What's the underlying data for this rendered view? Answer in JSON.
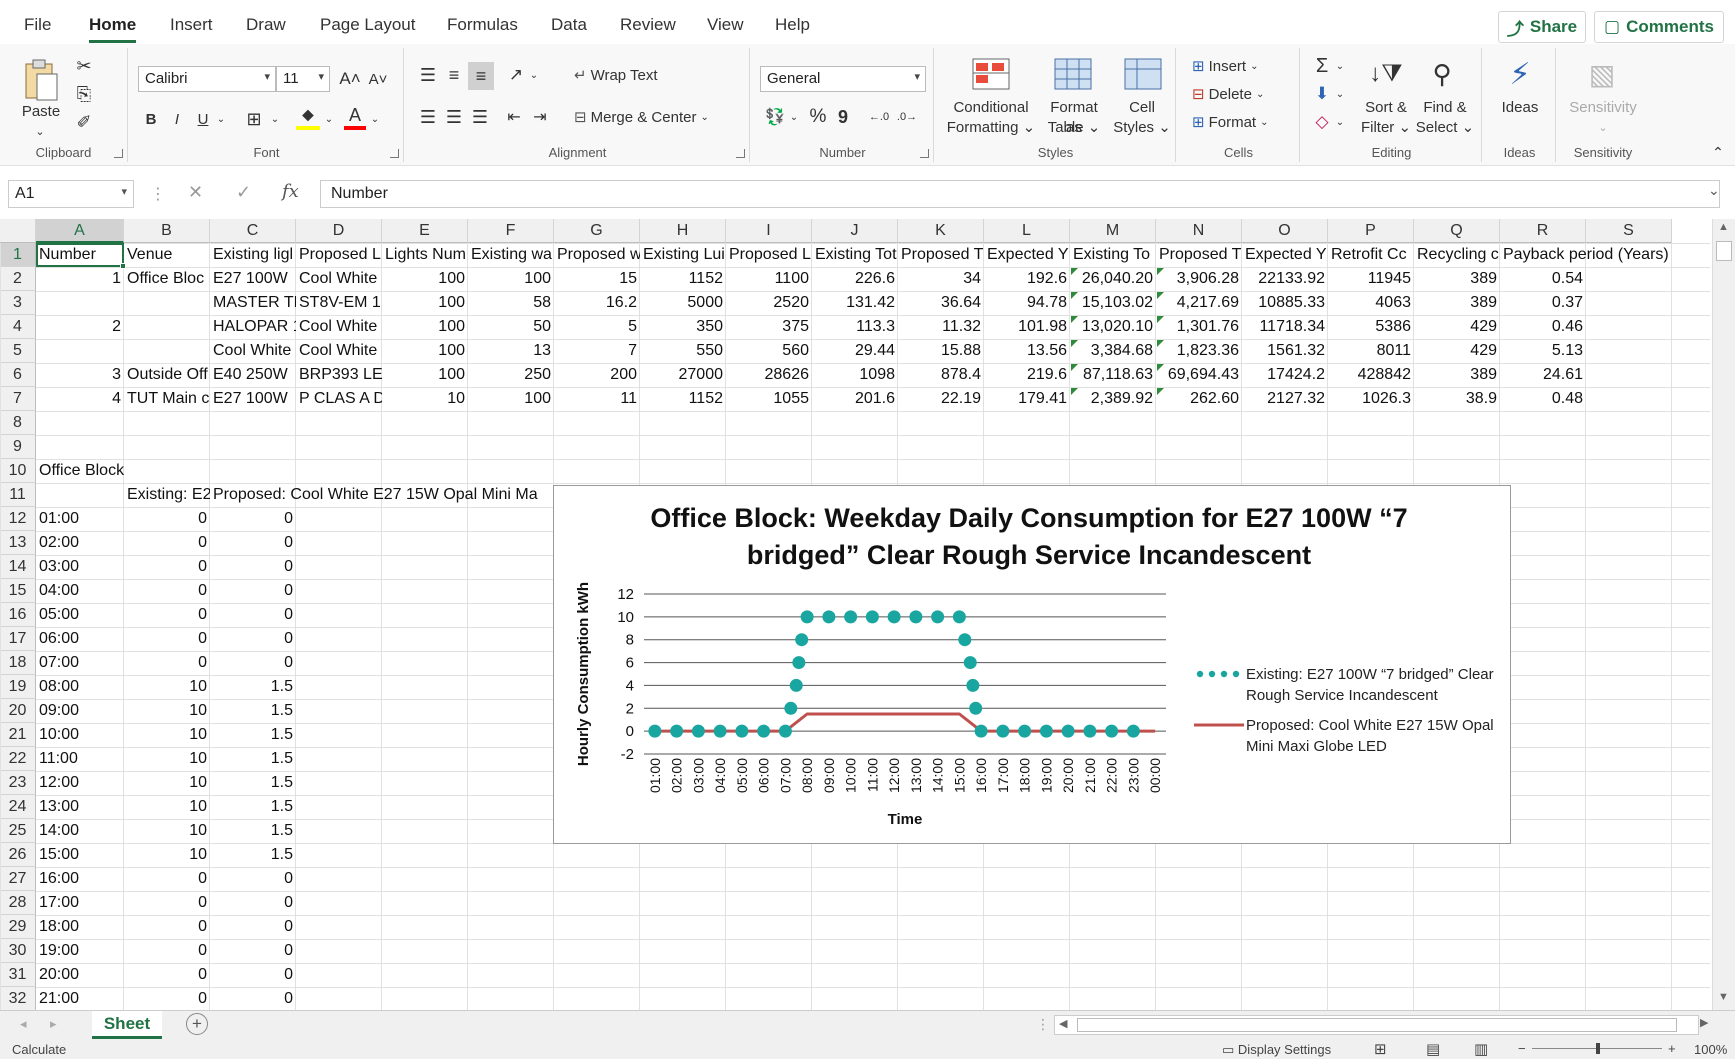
{
  "menu": {
    "tabs": [
      "File",
      "Home",
      "Insert",
      "Draw",
      "Page Layout",
      "Formulas",
      "Data",
      "Review",
      "View",
      "Help"
    ],
    "share_label": "Share",
    "comments_label": "Comments"
  },
  "ribbon": {
    "clipboard": {
      "paste_label": "Paste",
      "group_label": "Clipboard"
    },
    "font": {
      "font_name": "Calibri",
      "font_size": "11",
      "bold": "B",
      "italic": "I",
      "underline": "U",
      "group_label": "Font"
    },
    "alignment": {
      "wrap_text": "Wrap Text",
      "merge_center": "Merge & Center",
      "group_label": "Alignment"
    },
    "number": {
      "format": "General",
      "percent": "%",
      "comma": "9",
      "group_label": "Number"
    },
    "styles": {
      "conditional": "Conditional",
      "conditional2": "Formatting",
      "format_as": "Format as",
      "format_as2": "Table",
      "cell": "Cell",
      "cell2": "Styles",
      "group_label": "Styles"
    },
    "cells": {
      "insert": "Insert",
      "delete": "Delete",
      "format": "Format",
      "group_label": "Cells"
    },
    "editing": {
      "sort": "Sort &",
      "sort2": "Filter",
      "find": "Find &",
      "find2": "Select",
      "group_label": "Editing"
    },
    "ideas": {
      "label": "Ideas",
      "group_label": "Ideas"
    },
    "sensitivity": {
      "label": "Sensitivity",
      "group_label": "Sensitivity"
    }
  },
  "formula_bar": {
    "name_box": "A1",
    "fx": "fx",
    "content": "Number"
  },
  "columns": [
    "A",
    "B",
    "C",
    "D",
    "E",
    "F",
    "G",
    "H",
    "I",
    "J",
    "K",
    "L",
    "M",
    "N",
    "O",
    "P",
    "Q",
    "R",
    "S"
  ],
  "rows": [
    [
      "Number",
      "Venue",
      "Existing ligl",
      "Proposed L",
      "Lights Num",
      "Existing wa",
      "Proposed w",
      "Existing Lui",
      "Proposed L",
      "Existing Tot",
      "Proposed T",
      "Expected Y",
      "Existing To",
      "Proposed T",
      "Expected Y",
      "Retrofit Cc",
      "Recycling c",
      "Payback period (Years)",
      ""
    ],
    [
      "1",
      "Office Bloc",
      "E27 100W",
      "Cool White",
      "100",
      "100",
      "15",
      "1152",
      "1100",
      "226.6",
      "34",
      "192.6",
      "26,040.20",
      "3,906.28",
      "22133.92",
      "11945",
      "389",
      "0.54",
      ""
    ],
    [
      "",
      "",
      "MASTER TL",
      "ST8V-EM 1",
      "100",
      "58",
      "16.2",
      "5000",
      "2520",
      "131.42",
      "36.64",
      "94.78",
      "15,103.02",
      "4,217.69",
      "10885.33",
      "4063",
      "389",
      "0.37",
      ""
    ],
    [
      "2",
      "",
      "HALOPAR 1",
      "Cool White",
      "100",
      "50",
      "5",
      "350",
      "375",
      "113.3",
      "11.32",
      "101.98",
      "13,020.10",
      "1,301.76",
      "11718.34",
      "5386",
      "429",
      "0.46",
      ""
    ],
    [
      "",
      "",
      "Cool White",
      "Cool White",
      "100",
      "13",
      "7",
      "550",
      "560",
      "29.44",
      "15.88",
      "13.56",
      "3,384.68",
      "1,823.36",
      "1561.32",
      "8011",
      "429",
      "5.13",
      ""
    ],
    [
      "3",
      "Outside Off",
      "E40 250W",
      "BRP393 LEI",
      "100",
      "250",
      "200",
      "27000",
      "28626",
      "1098",
      "878.4",
      "219.6",
      "87,118.63",
      "69,694.43",
      "17424.2",
      "428842",
      "389",
      "24.61",
      ""
    ],
    [
      "4",
      "TUT Main c",
      "E27 100W",
      "P CLAS A D",
      "10",
      "100",
      "11",
      "1152",
      "1055",
      "201.6",
      "22.19",
      "179.41",
      "2,389.92",
      "262.60",
      "2127.32",
      "1026.3",
      "38.9",
      "0.48",
      ""
    ]
  ],
  "office_block_label": "Office Block",
  "series_header_existing": "Existing: E2",
  "series_header_proposed": "Proposed: Cool White E27 15W Opal Mini Ma",
  "hourly": [
    [
      "01:00",
      "0",
      "0"
    ],
    [
      "02:00",
      "0",
      "0"
    ],
    [
      "03:00",
      "0",
      "0"
    ],
    [
      "04:00",
      "0",
      "0"
    ],
    [
      "05:00",
      "0",
      "0"
    ],
    [
      "06:00",
      "0",
      "0"
    ],
    [
      "07:00",
      "0",
      "0"
    ],
    [
      "08:00",
      "10",
      "1.5"
    ],
    [
      "09:00",
      "10",
      "1.5"
    ],
    [
      "10:00",
      "10",
      "1.5"
    ],
    [
      "11:00",
      "10",
      "1.5"
    ],
    [
      "12:00",
      "10",
      "1.5"
    ],
    [
      "13:00",
      "10",
      "1.5"
    ],
    [
      "14:00",
      "10",
      "1.5"
    ],
    [
      "15:00",
      "10",
      "1.5"
    ],
    [
      "16:00",
      "0",
      "0"
    ],
    [
      "17:00",
      "0",
      "0"
    ],
    [
      "18:00",
      "0",
      "0"
    ],
    [
      "19:00",
      "0",
      "0"
    ],
    [
      "20:00",
      "0",
      "0"
    ],
    [
      "21:00",
      "0",
      "0"
    ]
  ],
  "chart_data": {
    "type": "line",
    "title": "Office Block: Weekday Daily Consumption for E27 100W “7 bridged” Clear Rough Service Incandescent",
    "xlabel": "Time",
    "ylabel": "Hourly Consumption kWh",
    "ylim": [
      -2,
      12
    ],
    "yticks": [
      "12",
      "10",
      "8",
      "6",
      "4",
      "2",
      "0",
      "-2"
    ],
    "grid": true,
    "legend_position": "right",
    "x": [
      "01:00",
      "02:00",
      "03:00",
      "04:00",
      "05:00",
      "06:00",
      "07:00",
      "08:00",
      "09:00",
      "10:00",
      "11:00",
      "12:00",
      "13:00",
      "14:00",
      "15:00",
      "16:00",
      "17:00",
      "18:00",
      "19:00",
      "20:00",
      "21:00",
      "22:00",
      "23:00",
      "00:00"
    ],
    "series": [
      {
        "name": "Existing: E27 100W “7 bridged” Clear Rough Service Incandescent",
        "style": "dots",
        "color": "#1aa6a0",
        "points": [
          [
            0,
            0
          ],
          [
            1,
            0
          ],
          [
            2,
            0
          ],
          [
            3,
            0
          ],
          [
            4,
            0
          ],
          [
            5,
            0
          ],
          [
            6,
            0
          ],
          [
            6.25,
            2
          ],
          [
            6.5,
            4
          ],
          [
            6.62,
            6
          ],
          [
            6.75,
            8
          ],
          [
            7,
            10
          ],
          [
            8,
            10
          ],
          [
            9,
            10
          ],
          [
            10,
            10
          ],
          [
            11,
            10
          ],
          [
            12,
            10
          ],
          [
            13,
            10
          ],
          [
            14,
            10
          ],
          [
            14.25,
            8
          ],
          [
            14.5,
            6
          ],
          [
            14.62,
            4
          ],
          [
            14.75,
            2
          ],
          [
            15,
            0
          ],
          [
            16,
            0
          ],
          [
            17,
            0
          ],
          [
            18,
            0
          ],
          [
            19,
            0
          ],
          [
            20,
            0
          ],
          [
            21,
            0
          ],
          [
            22,
            0
          ]
        ]
      },
      {
        "name": "Proposed: Cool White E27 15W Opal Mini Maxi Globe LED",
        "style": "line",
        "color": "#c0504d",
        "points": [
          [
            0,
            0
          ],
          [
            1,
            0
          ],
          [
            2,
            0
          ],
          [
            3,
            0
          ],
          [
            4,
            0
          ],
          [
            5,
            0
          ],
          [
            6,
            0
          ],
          [
            7,
            1.5
          ],
          [
            8,
            1.5
          ],
          [
            9,
            1.5
          ],
          [
            10,
            1.5
          ],
          [
            11,
            1.5
          ],
          [
            12,
            1.5
          ],
          [
            13,
            1.5
          ],
          [
            14,
            1.5
          ],
          [
            15,
            0
          ],
          [
            16,
            0
          ],
          [
            17,
            0
          ],
          [
            18,
            0
          ],
          [
            19,
            0
          ],
          [
            20,
            0
          ],
          [
            21,
            0
          ],
          [
            22,
            0
          ],
          [
            23,
            0
          ]
        ]
      }
    ],
    "legend": [
      {
        "line1": "Existing: E27 100W “7 bridged” Clear",
        "line2": "Rough Service Incandescent"
      },
      {
        "line1": "Proposed: Cool White E27 15W Opal",
        "line2": "Mini Maxi Globe LED"
      }
    ]
  },
  "sheet_tab": "Sheet",
  "status": {
    "left": "Calculate",
    "display_settings": "Display Settings",
    "zoom": "100%"
  },
  "colors": {
    "accent": "#217346",
    "teal": "#1aa6a0",
    "red": "#c0504d"
  }
}
